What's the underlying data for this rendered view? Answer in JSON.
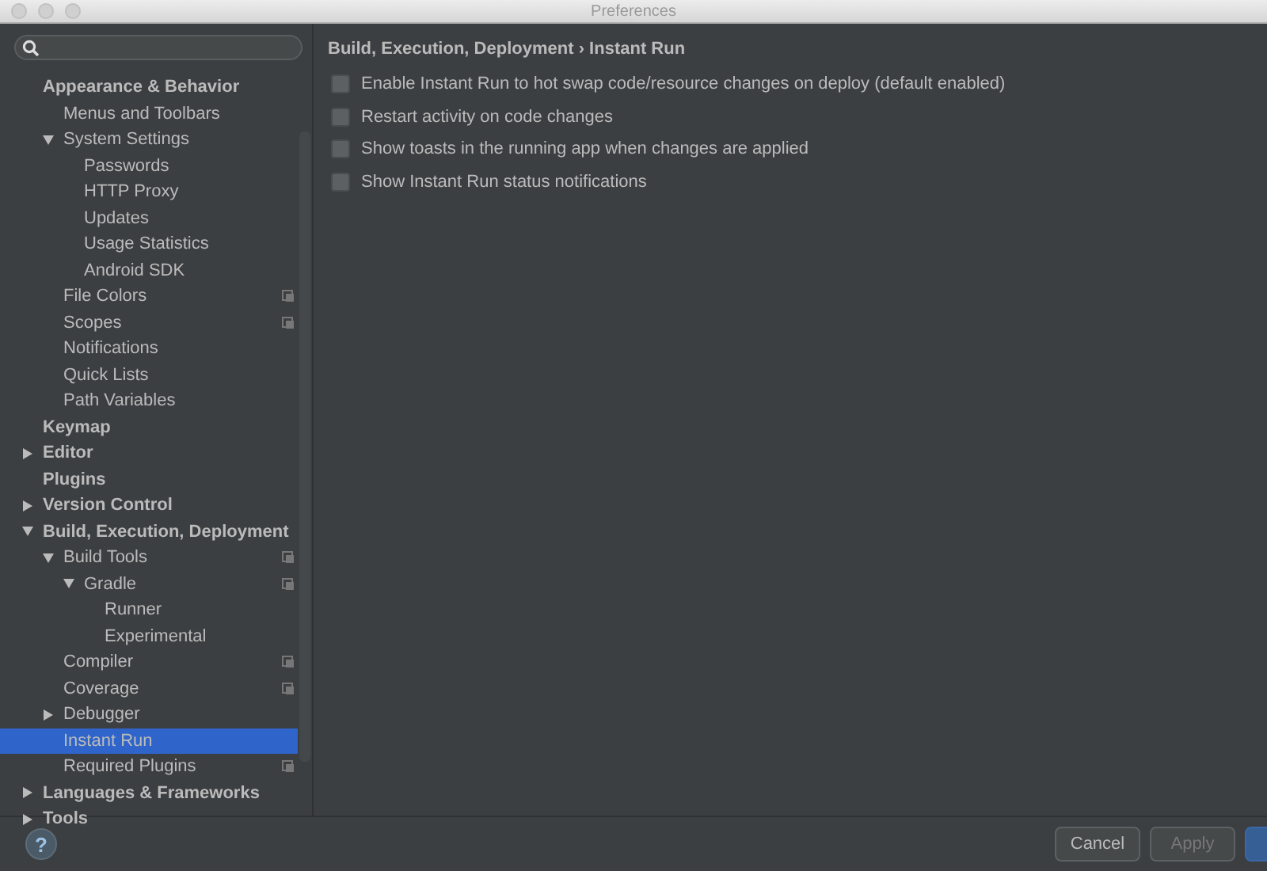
{
  "window": {
    "title": "Preferences"
  },
  "tree": [
    {
      "label": "Appearance & Behavior",
      "bold": true,
      "selected": false,
      "scope_icon": false,
      "children": [
        {
          "label": "Menus and Toolbars",
          "selected": false,
          "scope_icon": false
        },
        {
          "label": "System Settings",
          "expanded": true,
          "selected": false,
          "scope_icon": false,
          "children": [
            {
              "label": "Passwords",
              "selected": false,
              "scope_icon": false
            },
            {
              "label": "HTTP Proxy",
              "selected": false,
              "scope_icon": false
            },
            {
              "label": "Updates",
              "selected": false,
              "scope_icon": false
            },
            {
              "label": "Usage Statistics",
              "selected": false,
              "scope_icon": false
            },
            {
              "label": "Android SDK",
              "selected": false,
              "scope_icon": false
            }
          ]
        },
        {
          "label": "File Colors",
          "selected": false,
          "scope_icon": true
        },
        {
          "label": "Scopes",
          "selected": false,
          "scope_icon": true
        },
        {
          "label": "Notifications",
          "selected": false,
          "scope_icon": false
        },
        {
          "label": "Quick Lists",
          "selected": false,
          "scope_icon": false
        },
        {
          "label": "Path Variables",
          "selected": false,
          "scope_icon": false
        }
      ]
    },
    {
      "label": "Keymap",
      "bold": true,
      "selected": false,
      "scope_icon": false
    },
    {
      "label": "Editor",
      "bold": true,
      "expanded": false,
      "selected": false,
      "scope_icon": false
    },
    {
      "label": "Plugins",
      "bold": true,
      "selected": false,
      "scope_icon": false
    },
    {
      "label": "Version Control",
      "bold": true,
      "expanded": false,
      "selected": false,
      "scope_icon": false
    },
    {
      "label": "Build, Execution, Deployment",
      "bold": true,
      "expanded": true,
      "selected": false,
      "scope_icon": false,
      "children": [
        {
          "label": "Build Tools",
          "expanded": true,
          "selected": false,
          "scope_icon": true,
          "children": [
            {
              "label": "Gradle",
              "expanded": true,
              "selected": false,
              "scope_icon": true,
              "children": [
                {
                  "label": "Runner",
                  "selected": false,
                  "scope_icon": false
                },
                {
                  "label": "Experimental",
                  "selected": false,
                  "scope_icon": false
                }
              ]
            }
          ]
        },
        {
          "label": "Compiler",
          "selected": false,
          "scope_icon": true
        },
        {
          "label": "Coverage",
          "selected": false,
          "scope_icon": true
        },
        {
          "label": "Debugger",
          "expanded": false,
          "selected": false,
          "scope_icon": false
        },
        {
          "label": "Instant Run",
          "selected": true,
          "scope_icon": false
        },
        {
          "label": "Required Plugins",
          "selected": false,
          "scope_icon": true
        }
      ]
    },
    {
      "label": "Languages & Frameworks",
      "bold": true,
      "expanded": false,
      "selected": false,
      "scope_icon": false
    },
    {
      "label": "Tools",
      "bold": true,
      "expanded": false,
      "selected": false,
      "scope_icon": false
    }
  ],
  "breadcrumb": {
    "parent": "Build, Execution, Deployment",
    "separator": "›",
    "current": "Instant Run"
  },
  "options": [
    {
      "label": "Enable Instant Run to hot swap code/resource changes on deploy (default enabled)",
      "checked": false
    },
    {
      "label": "Restart activity on code changes",
      "checked": false
    },
    {
      "label": "Show toasts in the running app when changes are applied",
      "checked": false
    },
    {
      "label": "Show Instant Run status notifications",
      "checked": false
    }
  ],
  "help": {
    "label": "?"
  },
  "buttons": [
    {
      "kind": "normal",
      "label": "Cancel",
      "disabled": false
    },
    {
      "kind": "normal",
      "label": "Apply",
      "disabled": true
    },
    {
      "kind": "primary",
      "disabled": false
    }
  ]
}
